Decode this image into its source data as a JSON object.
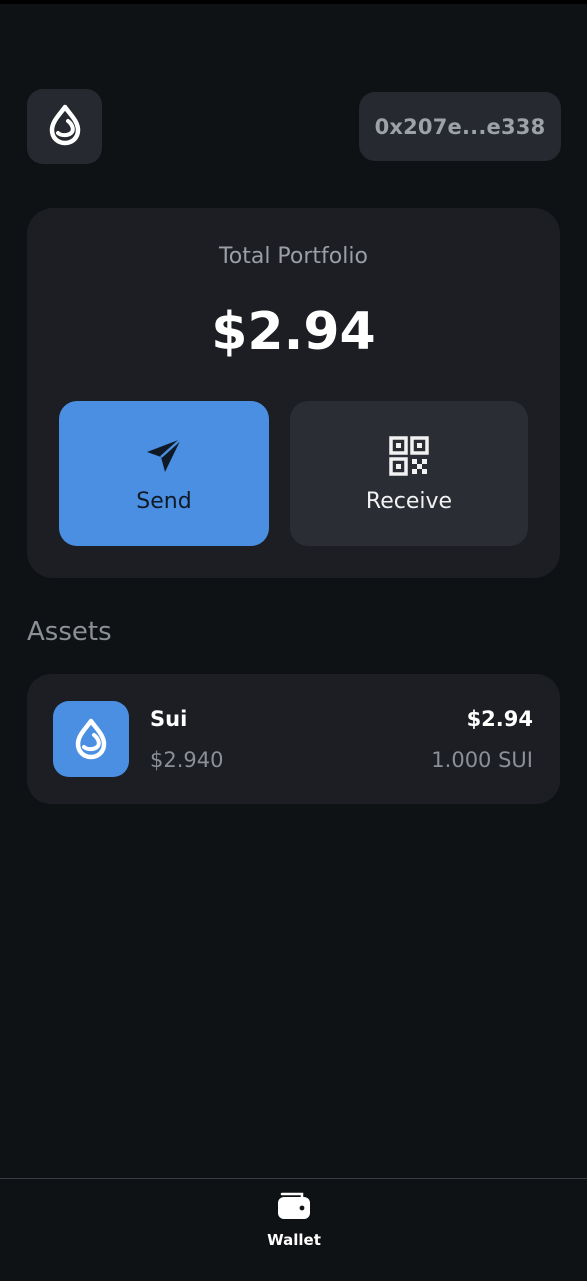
{
  "header": {
    "logo_icon": "sui-drop-icon",
    "address": "0x207e...e338"
  },
  "portfolio": {
    "label": "Total Portfolio",
    "value": "$2.94",
    "send_label": "Send",
    "send_icon": "send-icon",
    "receive_label": "Receive",
    "receive_icon": "qr-code-icon"
  },
  "assets": {
    "heading": "Assets",
    "items": [
      {
        "icon": "sui-drop-icon",
        "name": "Sui",
        "price": "$2.940",
        "value": "$2.94",
        "amount": "1.000 SUI"
      }
    ]
  },
  "nav": {
    "wallet_label": "Wallet",
    "wallet_icon": "wallet-icon"
  },
  "colors": {
    "background": "#0f1214",
    "card": "#1c1e24",
    "accent": "#4b8fe2",
    "muted_text": "#8b8f96"
  }
}
